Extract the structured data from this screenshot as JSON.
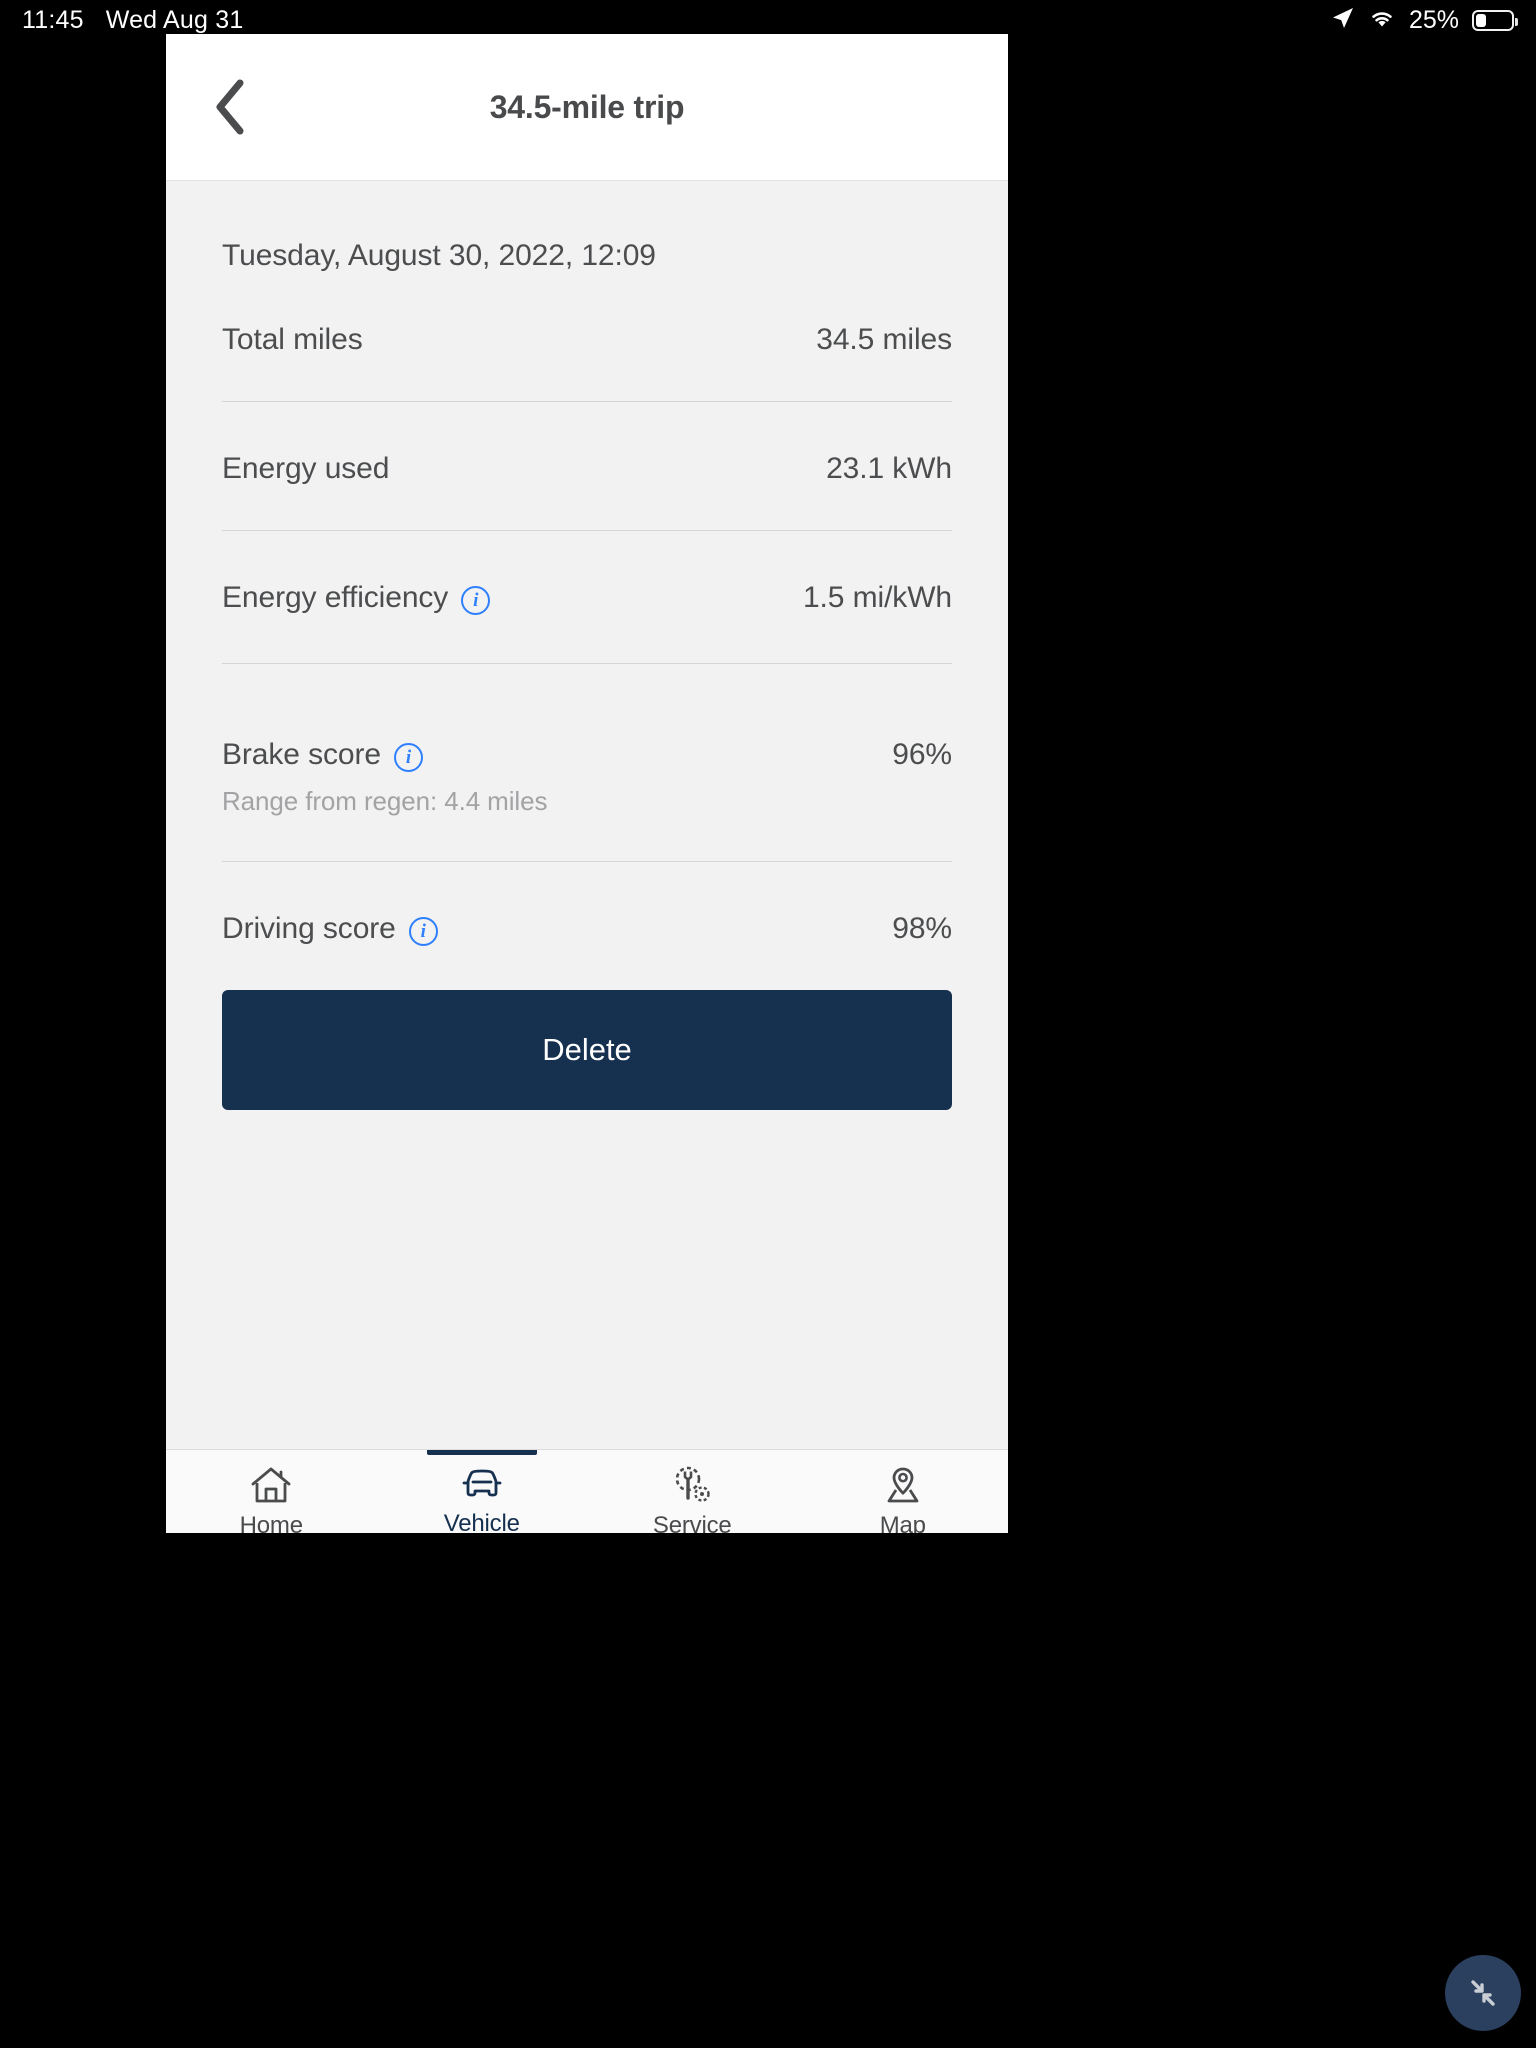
{
  "status_bar": {
    "time": "11:45",
    "date": "Wed Aug 31",
    "battery_percent": "25%",
    "location_icon": "location-arrow-icon",
    "wifi_icon": "wifi-icon",
    "battery_icon": "battery-icon",
    "battery_level": 25
  },
  "nav": {
    "back_icon": "chevron-left-icon",
    "title": "34.5-mile trip"
  },
  "trip": {
    "date": "Tuesday, August 30, 2022, 12:09",
    "rows": [
      {
        "label": "Total miles",
        "value": "34.5 miles",
        "info": false
      },
      {
        "label": "Energy used",
        "value": "23.1 kWh",
        "info": false
      },
      {
        "label": "Energy efficiency",
        "value": "1.5 mi/kWh",
        "info": true
      },
      {
        "label": "Brake score",
        "value": "96%",
        "info": true,
        "sub": "Range from regen: 4.4 miles"
      },
      {
        "label": "Driving score",
        "value": "98%",
        "info": true
      }
    ],
    "delete_label": "Delete"
  },
  "tabs": [
    {
      "label": "Home",
      "icon": "home-icon",
      "active": false
    },
    {
      "label": "Vehicle",
      "icon": "car-icon",
      "active": true
    },
    {
      "label": "Service",
      "icon": "service-icon",
      "active": false
    },
    {
      "label": "Map",
      "icon": "map-pin-icon",
      "active": false
    }
  ],
  "fab": {
    "icon": "collapse-arrows-icon"
  },
  "colors": {
    "accent_navy": "#16304f",
    "info_blue": "#2f80ff",
    "page_bg": "#f2f2f2",
    "text": "#4c4d4f",
    "muted_text": "#a3a3a5"
  }
}
